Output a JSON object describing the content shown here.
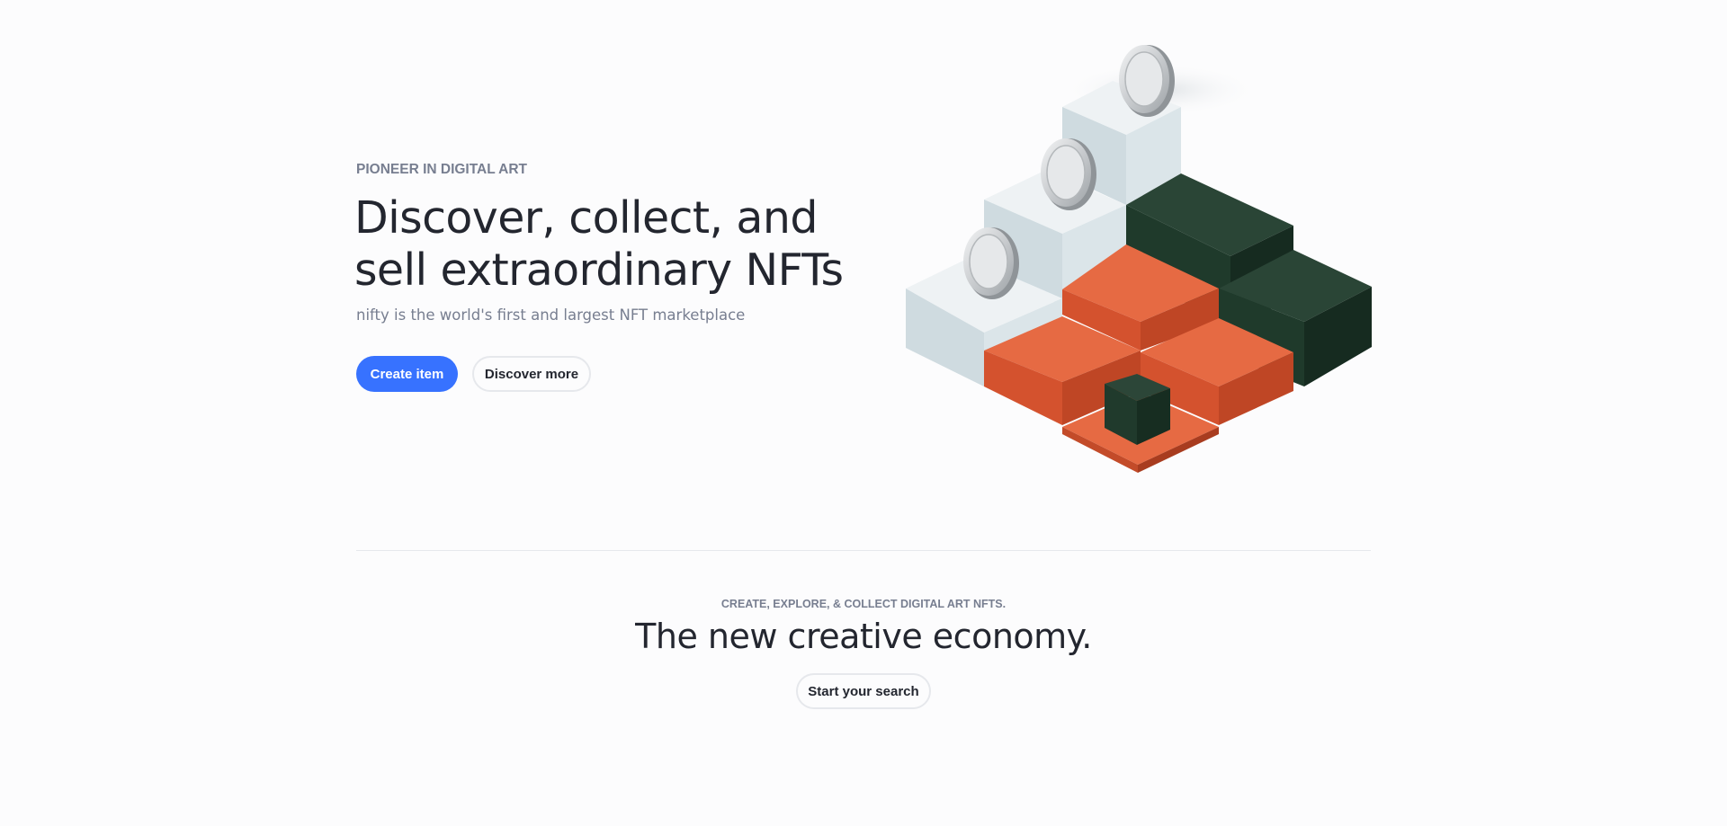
{
  "hero": {
    "eyebrow": "PIONEER IN DIGITAL ART",
    "title": "Discover, collect, and sell extraordinary NFTs",
    "subtitle": "nifty is the world's first and largest NFT marketplace",
    "primary_button_label": "Create item",
    "secondary_button_label": "Discover more"
  },
  "section": {
    "eyebrow": "CREATE, EXPLORE, & COLLECT DIGITAL ART NFTS.",
    "title": "The new creative economy.",
    "button_label": "Start your search"
  },
  "colors": {
    "primary": "#3772ff",
    "heading": "#23262f",
    "muted": "#777e90",
    "border": "#e6e8ec",
    "background": "#fcfcfd",
    "block_white": "#dce6ea",
    "block_orange": "#e25b35",
    "block_green": "#213b2d",
    "coin": "#cfd2d4"
  }
}
